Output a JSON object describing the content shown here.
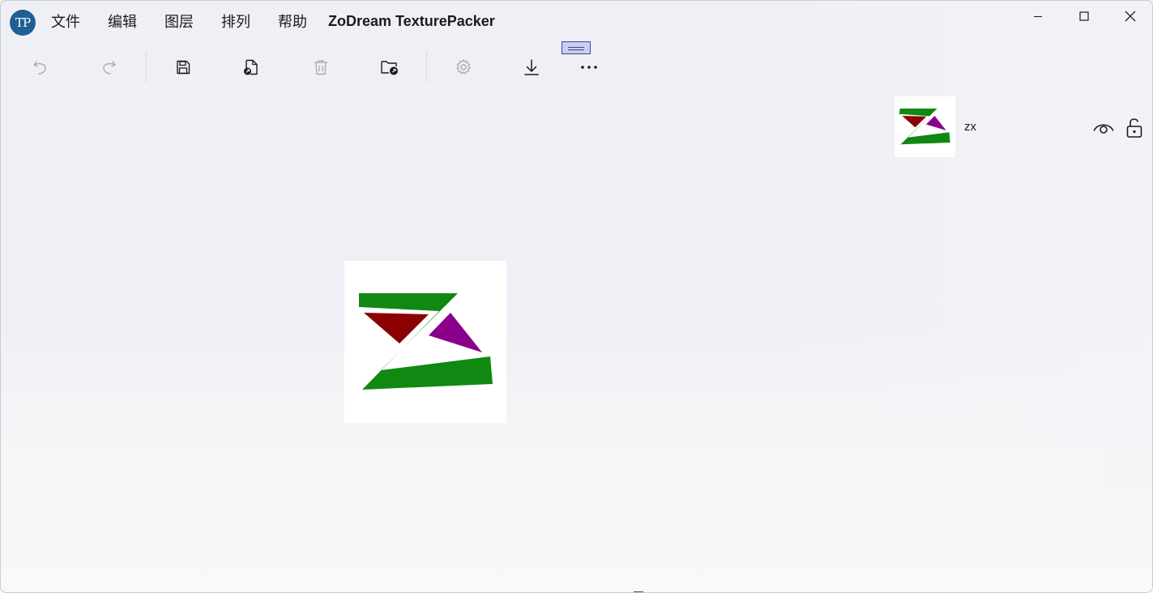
{
  "app": {
    "logo_text": "TP",
    "title": "ZoDream TexturePacker"
  },
  "menu": {
    "items": [
      {
        "label": "文件"
      },
      {
        "label": "编辑"
      },
      {
        "label": "图层"
      },
      {
        "label": "排列"
      },
      {
        "label": "帮助"
      }
    ]
  },
  "window_controls": [
    "minimize-icon",
    "maximize-icon",
    "close-icon"
  ],
  "toolbar": {
    "buttons": [
      {
        "icon": "undo-icon",
        "enabled": false
      },
      {
        "icon": "redo-icon",
        "enabled": false
      },
      {
        "icon": "save-icon",
        "enabled": true
      },
      {
        "icon": "export-file-icon",
        "enabled": true
      },
      {
        "icon": "delete-icon",
        "enabled": false
      },
      {
        "icon": "open-folder-icon",
        "enabled": true
      },
      {
        "icon": "settings-icon",
        "enabled": false
      },
      {
        "icon": "download-icon",
        "enabled": true
      },
      {
        "icon": "more-icon",
        "enabled": true
      }
    ]
  },
  "layers": [
    {
      "name": "zx",
      "visible": true,
      "locked": false
    }
  ],
  "colors": {
    "logo_green": "#118811",
    "logo_red": "#8b0000",
    "logo_purple": "#8b008b",
    "app_logo_bg": "#1f5f94"
  }
}
